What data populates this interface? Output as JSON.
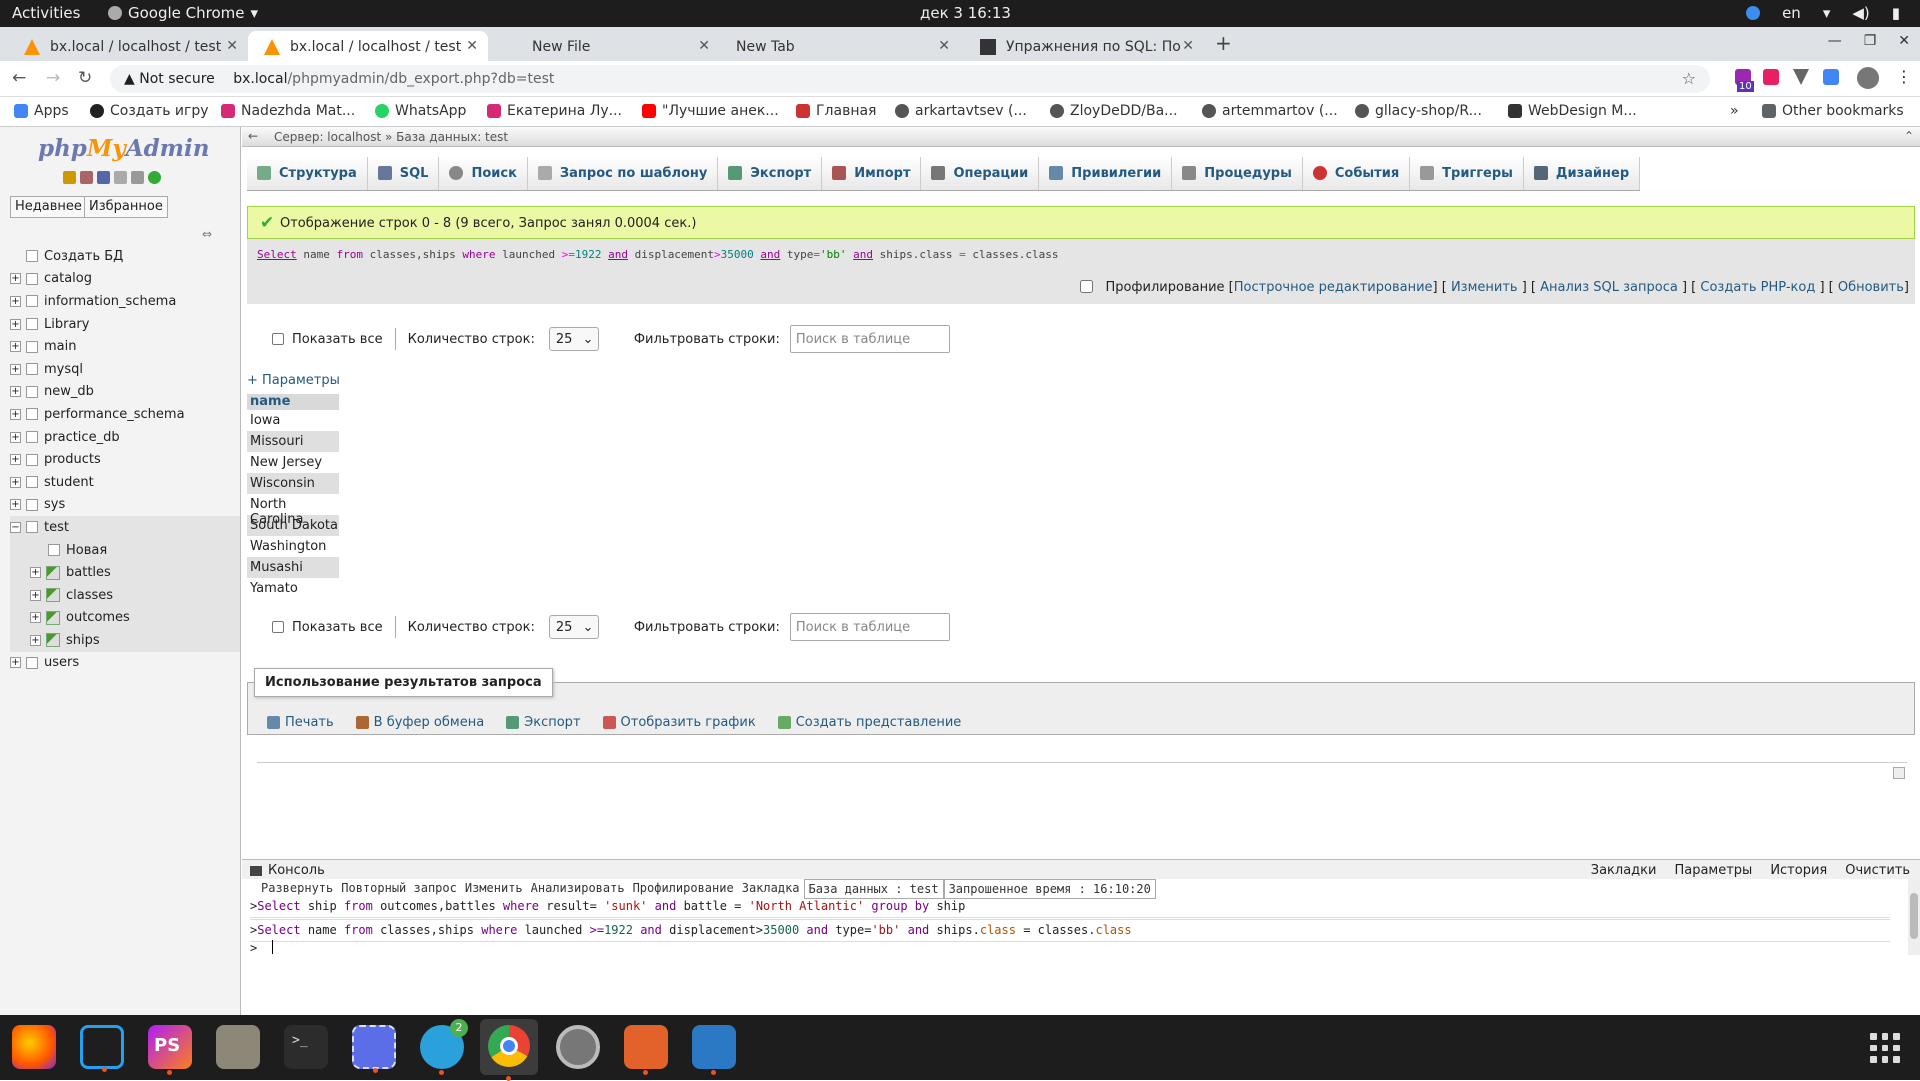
{
  "system": {
    "activities": "Activities",
    "app_name": "Google Chrome",
    "clock": "дек 3  16:13",
    "lang": "en"
  },
  "browser": {
    "tabs": [
      {
        "title": "bx.local / localhost / test"
      },
      {
        "title": "bx.local / localhost / test"
      },
      {
        "title": "New File"
      },
      {
        "title": "New Tab"
      },
      {
        "title": "Упражнения по SQL: По"
      }
    ],
    "security": "Not secure",
    "url_host": "bx.local",
    "url_path": "/phpmyadmin/db_export.php?db=test",
    "bookmarks": [
      {
        "label": "Apps",
        "color": "#4285f4"
      },
      {
        "label": "Создать игру",
        "color": "#222"
      },
      {
        "label": "Nadezhda Mat...",
        "color": "#d62976"
      },
      {
        "label": "WhatsApp",
        "color": "#25d366"
      },
      {
        "label": "Екатерина Лу...",
        "color": "#d62976"
      },
      {
        "label": "\"Лучшие анек...",
        "color": "#ff0000"
      },
      {
        "label": "Главная",
        "color": "#c33"
      },
      {
        "label": "arkartavtsev (...",
        "color": "#555"
      },
      {
        "label": "ZloyDeDD/Ba...",
        "color": "#555"
      },
      {
        "label": "artemmartov (...",
        "color": "#555"
      },
      {
        "label": "gllacy-shop/R...",
        "color": "#555"
      },
      {
        "label": "WebDesign M...",
        "color": "#333"
      }
    ],
    "other_bookmarks": "Other bookmarks",
    "ext_badge": "10"
  },
  "sidebar": {
    "recent": "Недавнее",
    "favorites": "Избранное",
    "create_db": "Создать БД",
    "databases": [
      "catalog",
      "information_schema",
      "Library",
      "main",
      "mysql",
      "new_db",
      "performance_schema",
      "practice_db",
      "products",
      "student",
      "sys"
    ],
    "expanded_db": "test",
    "new_table": "Новая",
    "tables": [
      "battles",
      "classes",
      "outcomes",
      "ships"
    ],
    "after_db": "users"
  },
  "main": {
    "breadcrumb": "Сервер: localhost »  База данных: test",
    "menu": [
      "Структура",
      "SQL",
      "Поиск",
      "Запрос по шаблону",
      "Экспорт",
      "Импорт",
      "Операции",
      "Привилегии",
      "Процедуры",
      "События",
      "Триггеры",
      "Дизайнер"
    ],
    "success": "Отображение строк 0 - 8 (9 всего, Запрос занял 0.0004 сек.)",
    "profiling": "Профилирование",
    "prof_links": [
      "Построчное редактирование",
      "Изменить",
      "Анализ SQL запроса",
      "Создать PHP-код",
      "Обновить"
    ],
    "show_all": "Показать все",
    "rows_label": "Количество строк:",
    "rows_value": "25",
    "filter_label": "Фильтровать строки:",
    "filter_placeholder": "Поиск в таблице",
    "params": "+ Параметры",
    "column": "name",
    "rows": [
      "Iowa",
      "Missouri",
      "New Jersey",
      "Wisconsin",
      "North Carolina",
      "South Dakota",
      "Washington",
      "Musashi",
      "Yamato"
    ],
    "use_results": "Использование результатов запроса",
    "actions": [
      "Печать",
      "В буфер обмена",
      "Экспорт",
      "Отобразить график",
      "Создать представление"
    ]
  },
  "console": {
    "title": "Консоль",
    "right": [
      "Закладки",
      "Параметры",
      "История",
      "Очистить"
    ],
    "toolbar": [
      "Развернуть",
      "Повторный запрос",
      "Изменить",
      "Анализировать",
      "Профилирование",
      "Закладка"
    ],
    "db_label": "База данных : test",
    "time_label": "Запрошенное время : 16:10:20",
    "prompt": ">"
  }
}
